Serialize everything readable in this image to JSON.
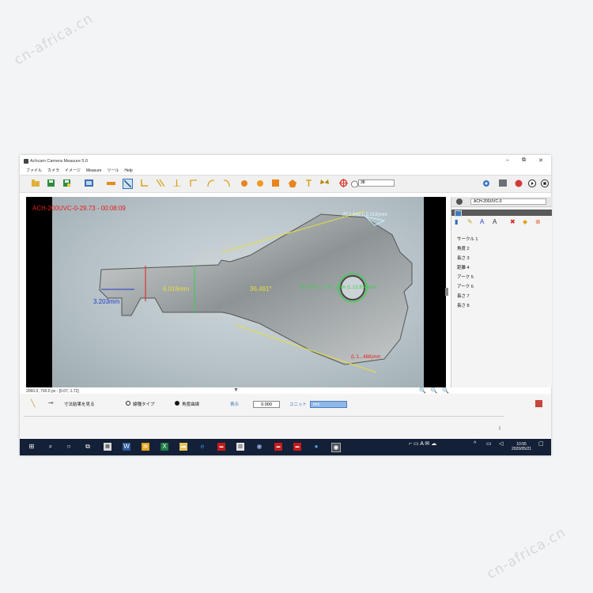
{
  "watermarks": [
    "cn-africa.cn",
    "cn-africa.cn"
  ],
  "window": {
    "title": "Achcam Camera Measure 5.0",
    "controls": [
      "–",
      "⧉",
      "✕"
    ]
  },
  "menu": [
    "ファイル",
    "カメラ",
    "イメージ",
    "Measure",
    "ツール",
    "Help"
  ],
  "toolbar": {
    "zoom_value": "38"
  },
  "viewer": {
    "overlay": "ACH-200UVC-0-29.73 - 00:08:09",
    "measurements": {
      "length_a": "6.016mm",
      "length_b": "3.203mm",
      "angle": "36.491°",
      "circle": "(R:1.649 L:2.018)mm",
      "circle_mid": "(R:2.971,L:1.70...)mm  (L:12.834)mm",
      "bottom": "(L:1...488)mm"
    },
    "coords": "2060.0, 700.0 px - [0.07, 1.72]",
    "zoom_icons": "🔍 🔍 🔍"
  },
  "side": {
    "camera": "ACH-200UVC-0",
    "measurement_list": [
      "サークル 1",
      "角度 2",
      "長さ 3",
      "距離 4",
      "アーク 5",
      "アーク 6",
      "長さ 7",
      "長さ 8"
    ]
  },
  "bottom": {
    "show_results": "寸法結果を見る",
    "line_type": "線種タイプ",
    "angle_arc": "角度曲線",
    "display_label": "表示",
    "value": "0.000",
    "unit_label": "ユニット",
    "unit_value": "mm"
  },
  "taskbar": {
    "time": "10:55",
    "date": "2020/05/21"
  },
  "colors": {
    "measure_yellow": "#e6df3a",
    "measure_green": "#39d14a",
    "measure_blue": "#1f3cc9",
    "measure_red": "#e81c1c",
    "measure_cyan": "#bff3ff"
  }
}
